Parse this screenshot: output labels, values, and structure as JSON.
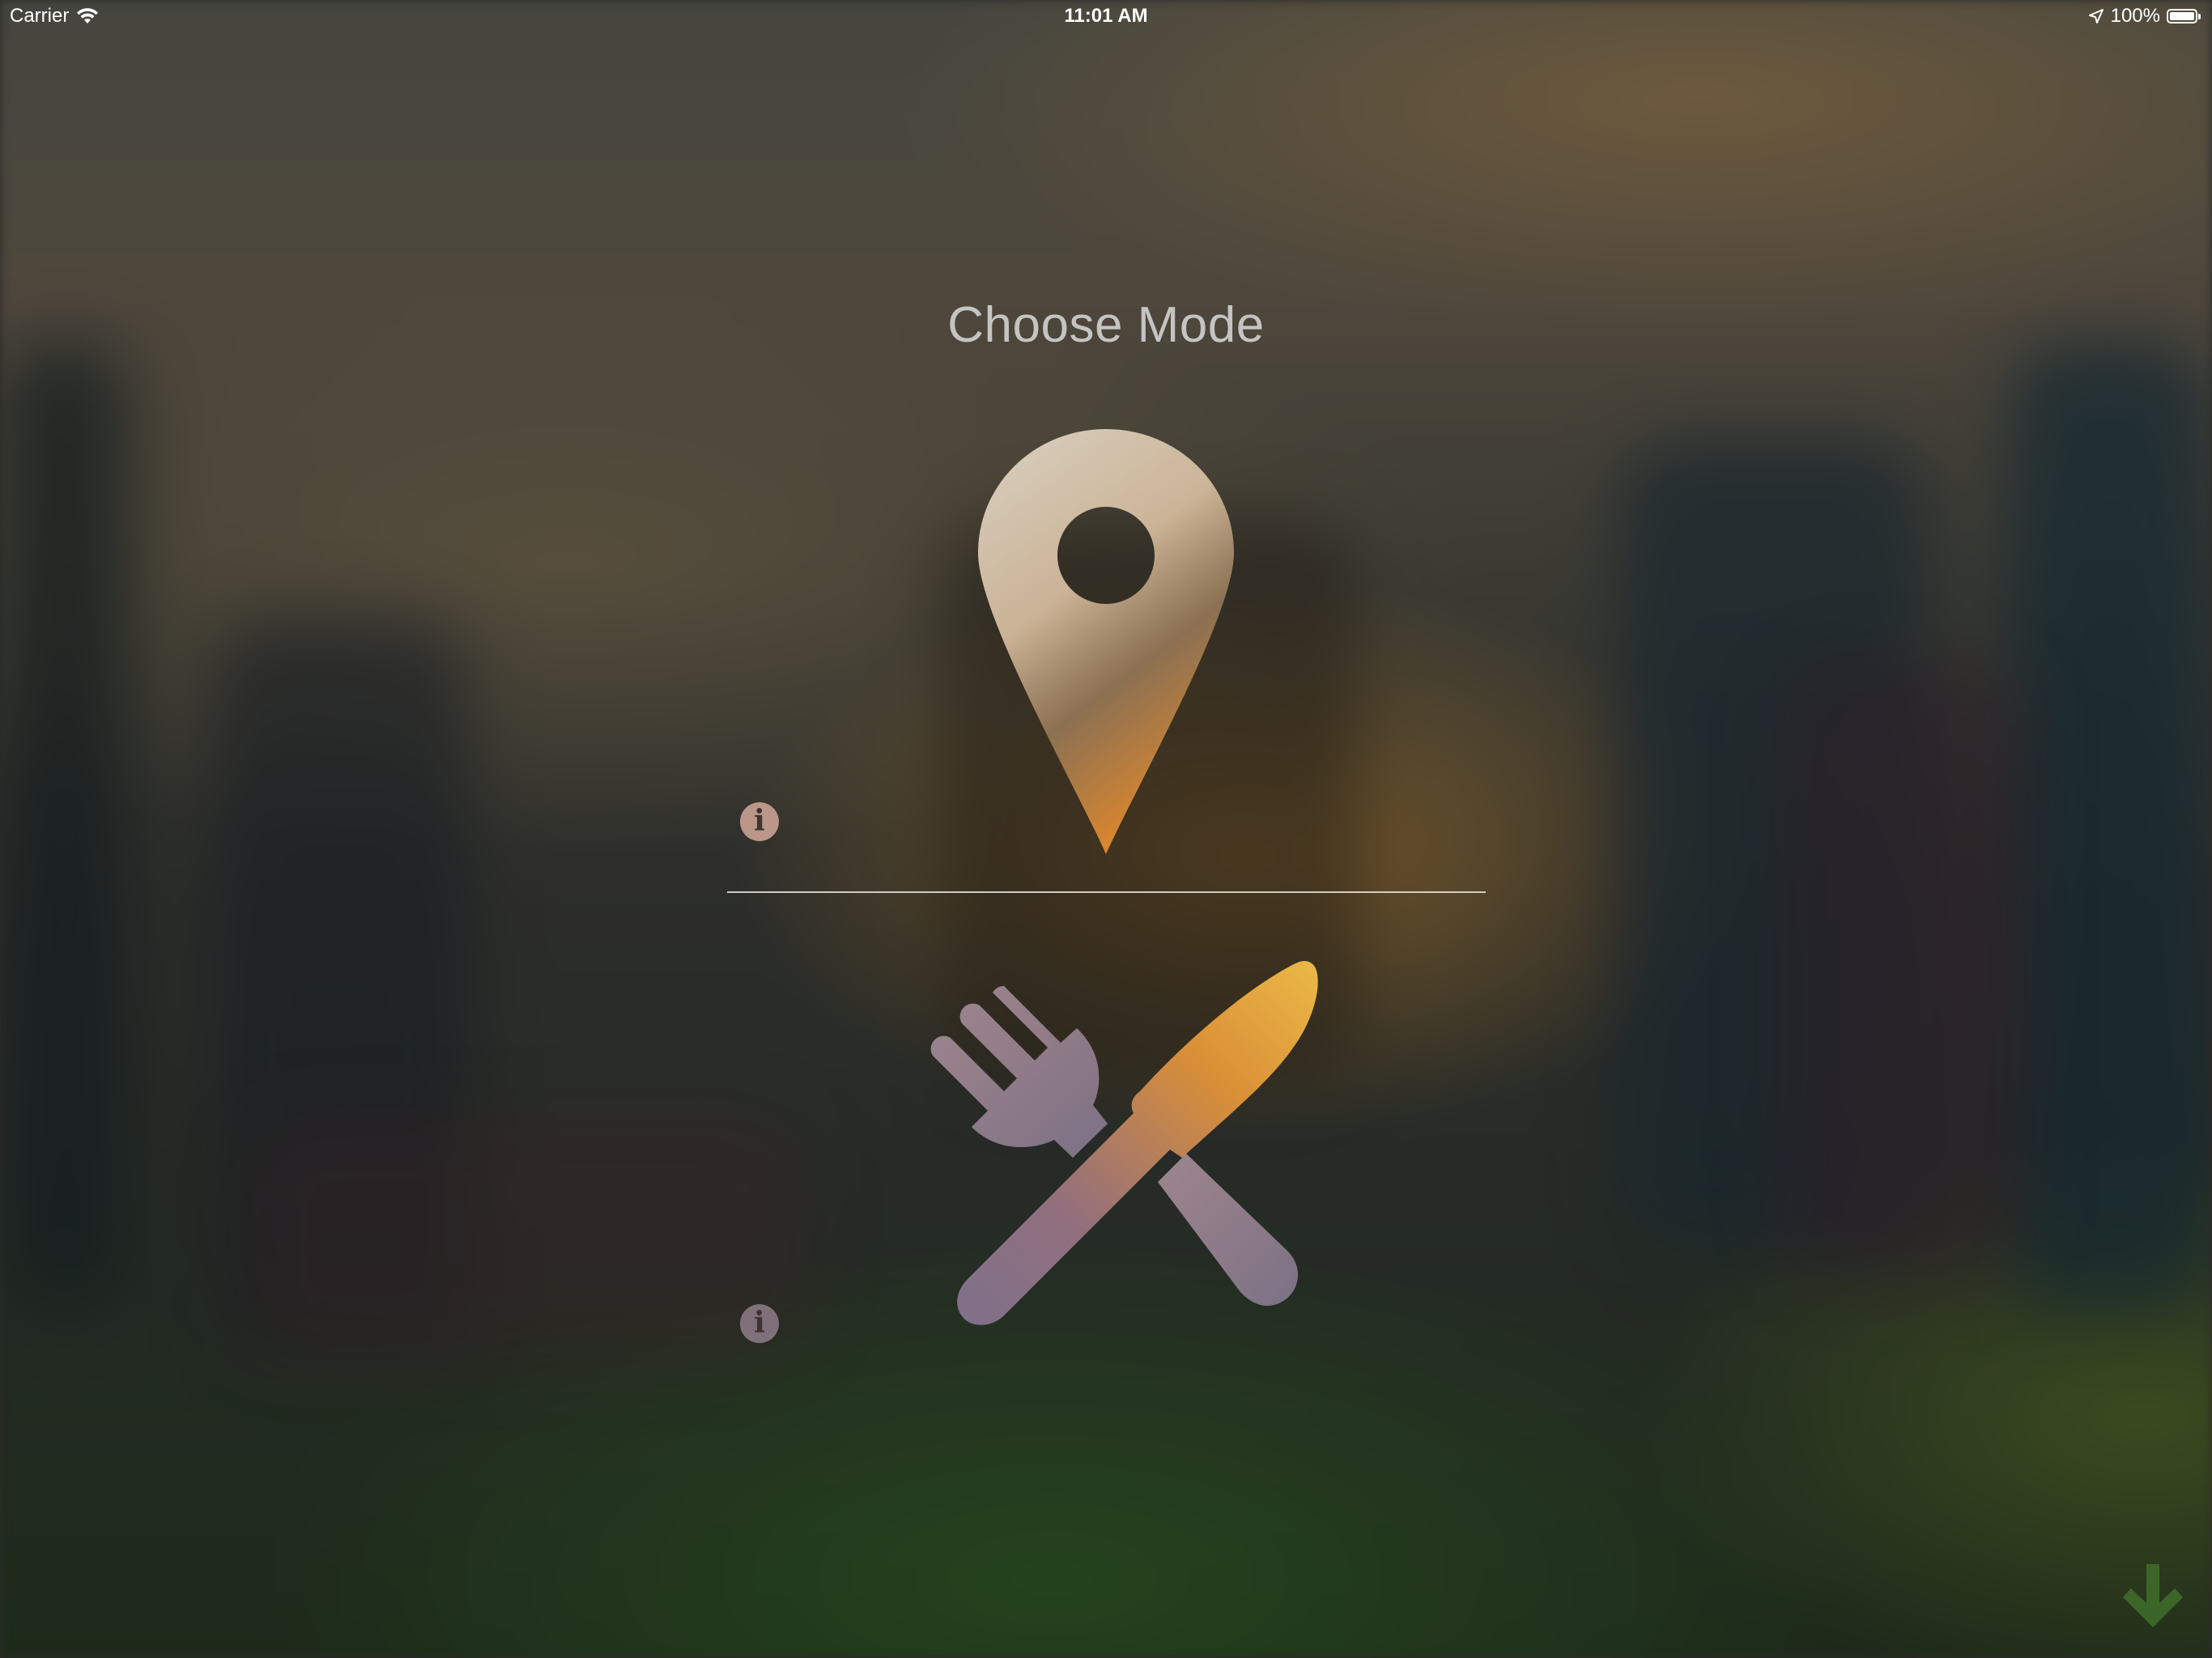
{
  "status_bar": {
    "carrier": "Carrier",
    "time": "11:01 AM",
    "battery": "100%"
  },
  "header": {
    "title": "Choose Mode"
  },
  "modes": [
    {
      "icon": "location-pin-icon",
      "info_icon": "info-icon"
    },
    {
      "icon": "fork-and-knife-icon",
      "info_icon": "info-icon"
    }
  ],
  "info_glyph": "i",
  "colors": {
    "title": "#d8d8d8",
    "divider": "#ebe6e1",
    "next_arrow": "#3f6f2a",
    "info_badge": "#cda596"
  },
  "footer": {
    "next_icon": "down-arrow-icon"
  }
}
